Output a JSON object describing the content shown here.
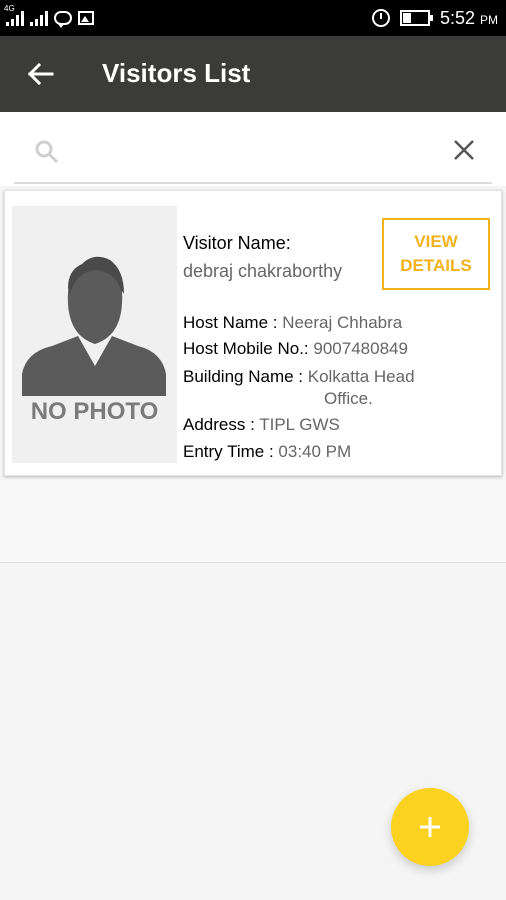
{
  "status_bar": {
    "network_label": "4G",
    "time": "5:52",
    "ampm": "PM",
    "icons": [
      "signal-icon",
      "signal-icon",
      "chat-icon",
      "image-icon",
      "alarm-icon",
      "battery-icon"
    ]
  },
  "app_bar": {
    "title": "Visitors List",
    "back_icon": "arrow-left-icon"
  },
  "search": {
    "value": "",
    "placeholder": "",
    "icons": [
      "search-icon",
      "close-icon"
    ]
  },
  "visitors": [
    {
      "photo_text": "NO PHOTO",
      "visitor_name_label": "Visitor Name:",
      "visitor_name": "debraj chakraborthy",
      "host_name_label": "Host Name : ",
      "host_name": "Neeraj Chhabra",
      "host_mobile_label": "Host Mobile No.: ",
      "host_mobile": "9007480849",
      "building_label": "Building Name : ",
      "building_line1": "Kolkatta Head",
      "building_line2": "Office.",
      "address_label": "Address : ",
      "address": "TIPL  GWS",
      "entry_time_label": "Entry Time : ",
      "entry_time": "03:40 PM",
      "view_details_label": "VIEW\nDETAILS"
    }
  ],
  "fab": {
    "icon": "plus-icon"
  },
  "colors": {
    "status_bar": "#000000",
    "app_bar": "#3b3b39",
    "accent": "#f2b21c",
    "fab": "#fbd21f",
    "background": "#f5f5f5"
  }
}
